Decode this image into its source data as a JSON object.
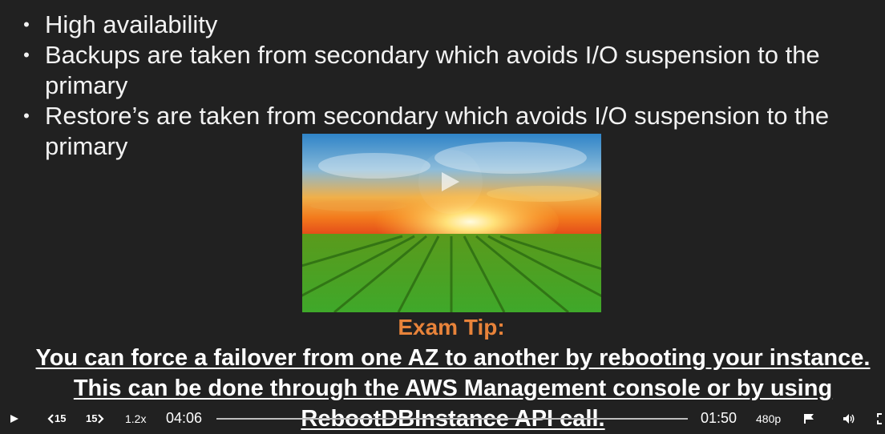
{
  "slide": {
    "bullets": [
      "High availability",
      "Backups are taken from secondary which avoids I/O suspension to the primary",
      "Restore’s are taken from secondary which avoids I/O suspension to the primary"
    ],
    "bullet_symbol": "•",
    "exam_tip_heading": "Exam Tip:",
    "exam_tip_body": "You can force a failover from one AZ to another by rebooting your instance. This can be done through the AWS Management console or by using RebootDBInstance API call.",
    "colors": {
      "background": "#212121",
      "exam_tip_heading": "#e8833a",
      "text": "#ffffff"
    }
  },
  "player": {
    "rewind_label": "15",
    "forward_label": "15",
    "speed": "1.2x",
    "current_time": "04:06",
    "remaining_time": "01:50",
    "quality": "480p",
    "progress": 0.0,
    "icons": [
      "play-icon",
      "rewind-15-icon",
      "forward-15-icon",
      "flag-icon",
      "volume-icon",
      "fullscreen-icon"
    ]
  }
}
